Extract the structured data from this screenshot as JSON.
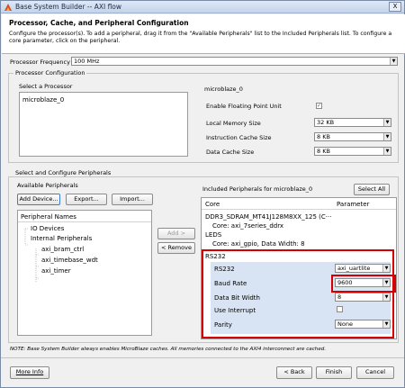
{
  "window": {
    "title": "Base System Builder -- AXI flow",
    "close_label": "X"
  },
  "header": {
    "title": "Processor, Cache, and Peripheral Configuration",
    "description": "Configure the processor(s). To add a peripheral, drag it from the \"Available Peripherals\" list to the Included Peripherals list. To configure a core parameter, click on the peripheral."
  },
  "processor_frequency": {
    "label": "Processor Frequency",
    "value": "100 MHz"
  },
  "processor_config": {
    "group_label": "Processor Configuration",
    "select_label": "Select a Processor",
    "processors": [
      "microblaze_0"
    ],
    "detail_title": "microblaze_0",
    "fpu_label": "Enable Floating Point Unit",
    "fpu_checked": "✓",
    "local_memory": {
      "label": "Local Memory Size",
      "value": "32 KB"
    },
    "icache": {
      "label": "Instruction Cache Size",
      "value": "8 KB"
    },
    "dcache": {
      "label": "Data Cache Size",
      "value": "8 KB"
    }
  },
  "peripherals": {
    "group_label": "Select and Configure Peripherals",
    "available_label": "Available Peripherals",
    "add_device": "Add Device...",
    "export": "Export...",
    "import": "Import...",
    "tree_header": "Peripheral Names",
    "tree": {
      "io_devices": "IO Devices",
      "internal": "Internal Peripherals",
      "items": [
        "axi_bram_ctrl",
        "axi_timebase_wdt",
        "axi_timer"
      ]
    },
    "add_btn": "Add >",
    "remove_btn": "< Remove",
    "included_label": "Included Peripherals for microblaze_0",
    "select_all": "Select All",
    "col_core": "Core",
    "col_param": "Parameter",
    "included": {
      "ddr": "DDR3_SDRAM_MT41J128M8XX_125 (C···",
      "ddr_core": "Core: axi_7series_ddrx",
      "leds": "LEDS",
      "leds_core": "Core: axi_gpio, Data Width: 8",
      "rs232": "RS232"
    },
    "rs232_params": {
      "core_label": "RS232",
      "core_value": "axi_uartlite",
      "baud_label": "Baud Rate",
      "baud_value": "9600",
      "width_label": "Data Bit Width",
      "width_value": "8",
      "irq_label": "Use Interrupt",
      "parity_label": "Parity",
      "parity_value": "None"
    }
  },
  "note": "NOTE: Base System Builder always enables MicroBlaze caches. All memories connected to the AXI4 interconnect are cached.",
  "footer": {
    "more_info": "More Info",
    "back": "< Back",
    "finish": "Finish",
    "cancel": "Cancel"
  },
  "colors": {
    "highlight_border": "#d40000",
    "param_row_bg": "#d8e4f4"
  }
}
